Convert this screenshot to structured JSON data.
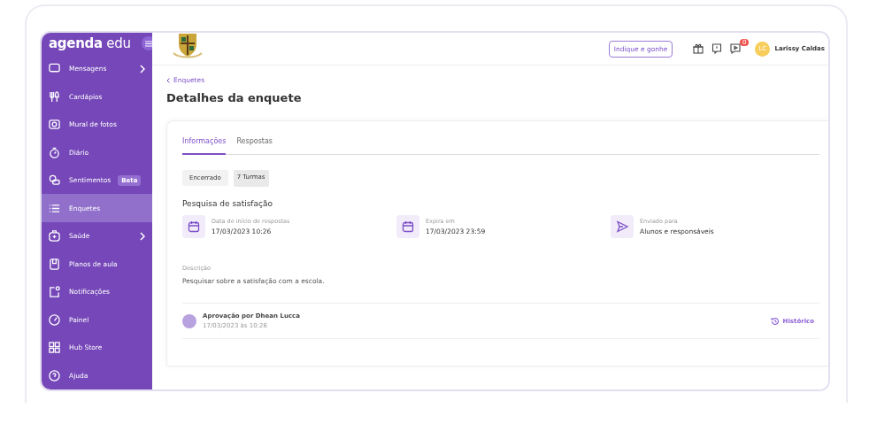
{
  "sidebar": {
    "logo": {
      "brand": "agenda",
      "suffix": "edu"
    },
    "items": [
      {
        "label": "Mensagens",
        "selected": false,
        "expandable": true
      },
      {
        "label": "Cardápios",
        "selected": false,
        "expandable": false
      },
      {
        "label": "Mural de fotos",
        "selected": false,
        "expandable": false
      },
      {
        "label": "Diário",
        "selected": false,
        "expandable": false
      },
      {
        "label": "Sentimentos",
        "selected": false,
        "expandable": false,
        "badge": "Beta"
      },
      {
        "label": "Enquetes",
        "selected": true,
        "expandable": false
      },
      {
        "label": "Saúde",
        "selected": false,
        "expandable": true
      },
      {
        "label": "Planos de aula",
        "selected": false,
        "expandable": false
      },
      {
        "label": "Notificações",
        "selected": false,
        "expandable": false
      },
      {
        "label": "Painel",
        "selected": false,
        "expandable": false
      },
      {
        "label": "Hub Store",
        "selected": false,
        "expandable": false
      },
      {
        "label": "Ajuda",
        "selected": false,
        "expandable": false
      }
    ]
  },
  "topbar": {
    "referral_button": "Indique e gonhe",
    "notification_count": "0",
    "user": {
      "initials": "LC",
      "name": "Larissy Caldas"
    }
  },
  "breadcrumb": "Enquetes",
  "title": "Detalhes da enquete",
  "tabs": [
    {
      "label": "Informações",
      "selected": true
    },
    {
      "label": "Respostas",
      "selected": false
    }
  ],
  "status_chip": "Encerrado",
  "classes_chip": "7 Turmas",
  "survey_name": "Pesquisa de satisfação",
  "details": [
    {
      "kind": "calendar",
      "label": "Data de início de respostas",
      "value": "17/03/2023 10:26"
    },
    {
      "kind": "calendar",
      "label": "Expira em",
      "value": "17/03/2023 23:59"
    },
    {
      "kind": "send",
      "label": "Enviado para",
      "value": "Alunos e responsáveis"
    }
  ],
  "description": {
    "label": "Descrição",
    "text": "Pesquisar sobre a satisfação com a escola."
  },
  "approval": {
    "title": "Aprovação por Dhean Lucca",
    "date": "17/03/2023 às 10:26",
    "history_link": "Histórico"
  }
}
